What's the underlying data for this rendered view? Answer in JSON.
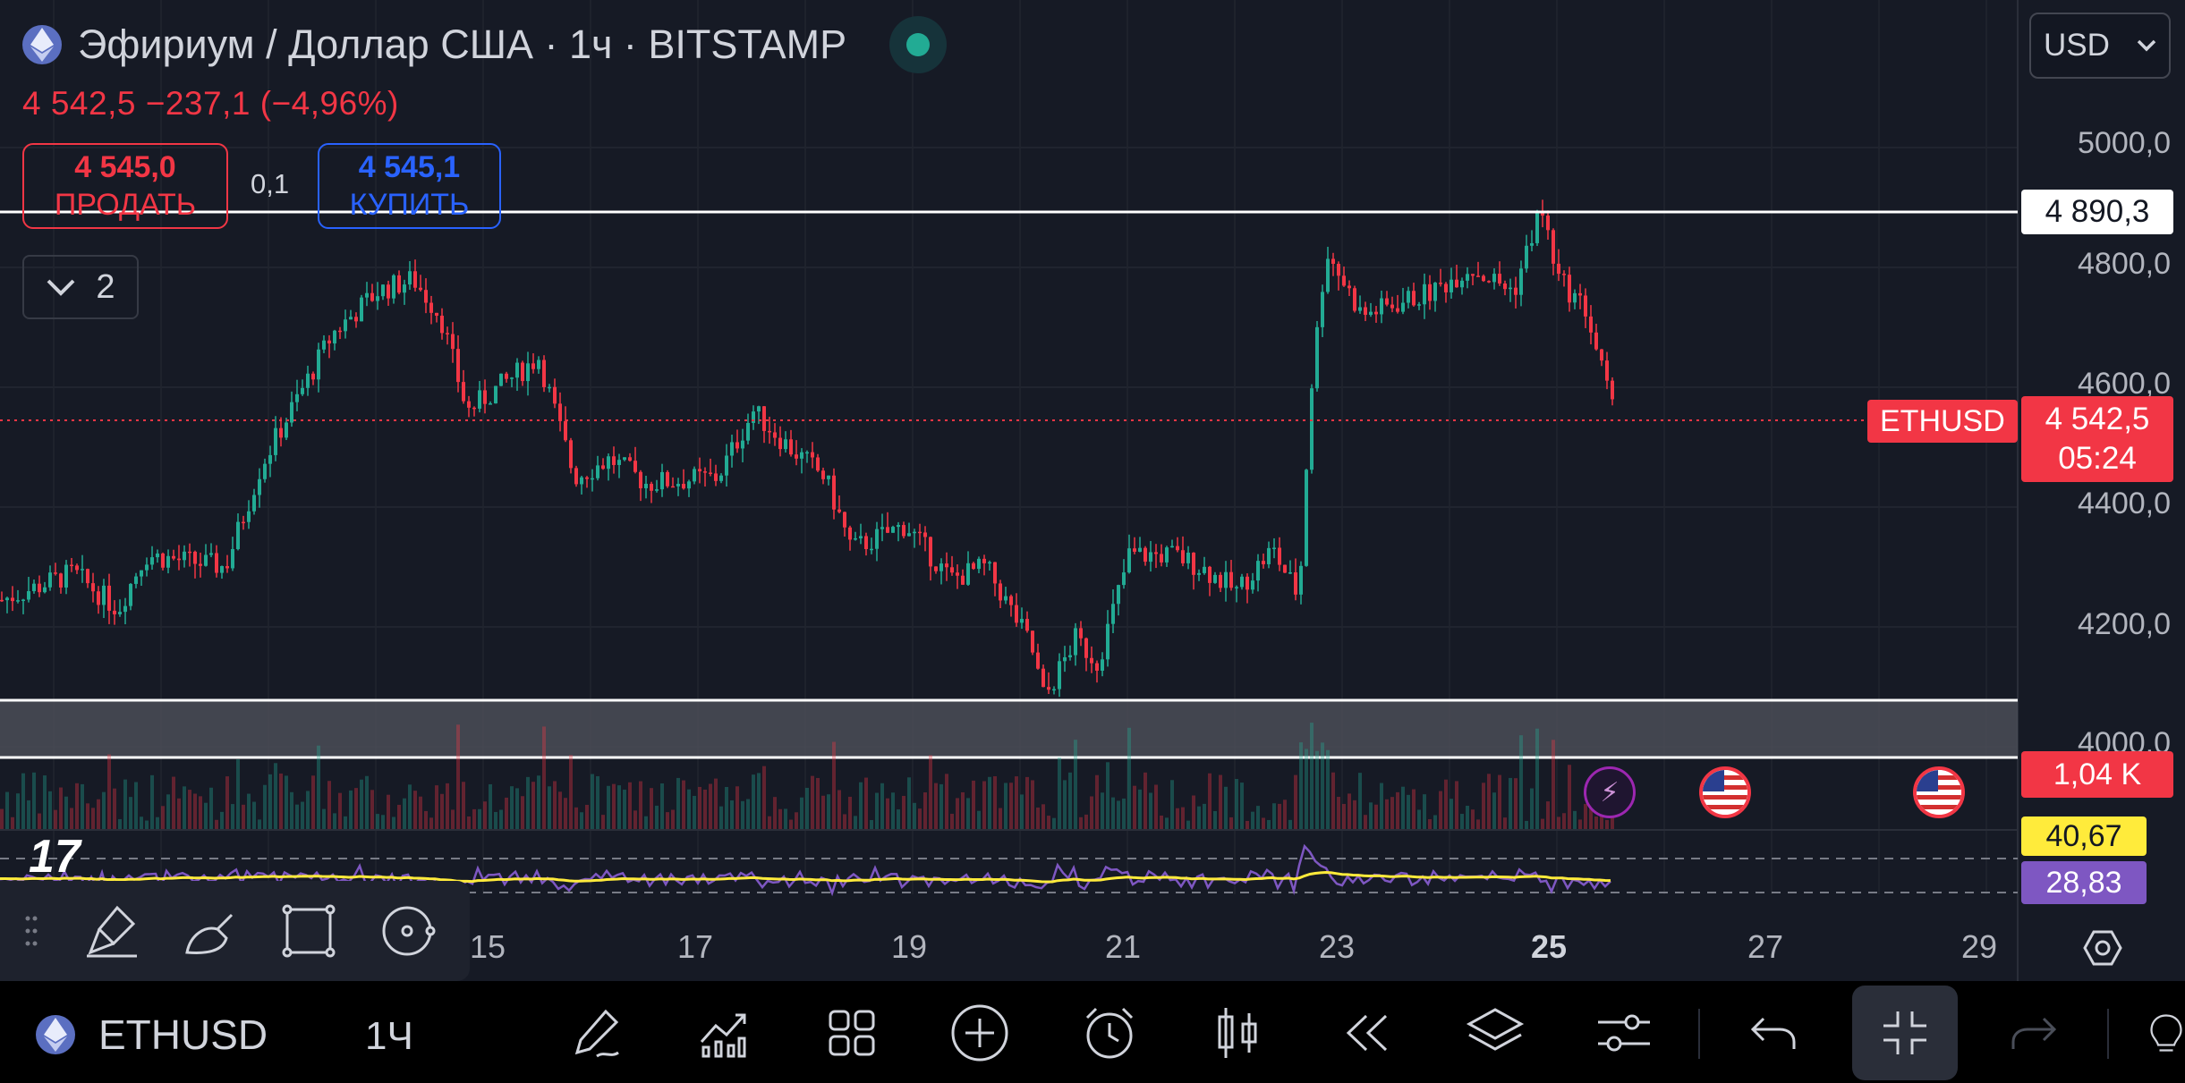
{
  "header": {
    "title": "Эфириум / Доллар США · 1ч · BITSTAMP",
    "price_line": "4 542,5  −237,1 (−4,96%)",
    "sell_price": "4 545,0",
    "sell_label": "ПРОДАТЬ",
    "spread": "0,1",
    "buy_price": "4 545,1",
    "buy_label": "КУПИТЬ",
    "indicators_count": "2",
    "currency": "USD"
  },
  "price_axis": {
    "labels": [
      "5000,0",
      "4800,0",
      "4600,0",
      "4400,0",
      "4200,0",
      "4000,0"
    ],
    "horizontal_line_value": "4 890,3",
    "symbol_tag": "ETHUSD",
    "last_price": "4 542,5",
    "countdown": "05:24",
    "volume_value": "1,04 K",
    "rsi_ma": "40,67",
    "rsi_value": "28,83"
  },
  "time_axis": {
    "labels": [
      "15",
      "17",
      "19",
      "21",
      "23",
      "25",
      "27",
      "29"
    ],
    "today": "25"
  },
  "bottom_bar": {
    "symbol": "ETHUSD",
    "timeframe": "1Ч"
  },
  "colors": {
    "up": "#22ab94",
    "down": "#f23645",
    "bg": "#161a25",
    "rsi_line": "#7e57c2",
    "rsi_ma": "#ffeb3b"
  },
  "chart_data": {
    "type": "candlestick",
    "series": [
      {
        "name": "ETHUSD",
        "x": [
          "14",
          "15",
          "16",
          "17",
          "18",
          "19",
          "20",
          "21",
          "22",
          "23",
          "24",
          "25"
        ],
        "close": [
          4280,
          4700,
          4640,
          4420,
          4580,
          4360,
          4130,
          4320,
          4230,
          4760,
          4780,
          4542.5
        ]
      }
    ],
    "ylim": [
      3950,
      5050
    ],
    "horizontal_line": 4890.3,
    "range_band": [
      3985,
      4080
    ],
    "last": 4542.5
  }
}
